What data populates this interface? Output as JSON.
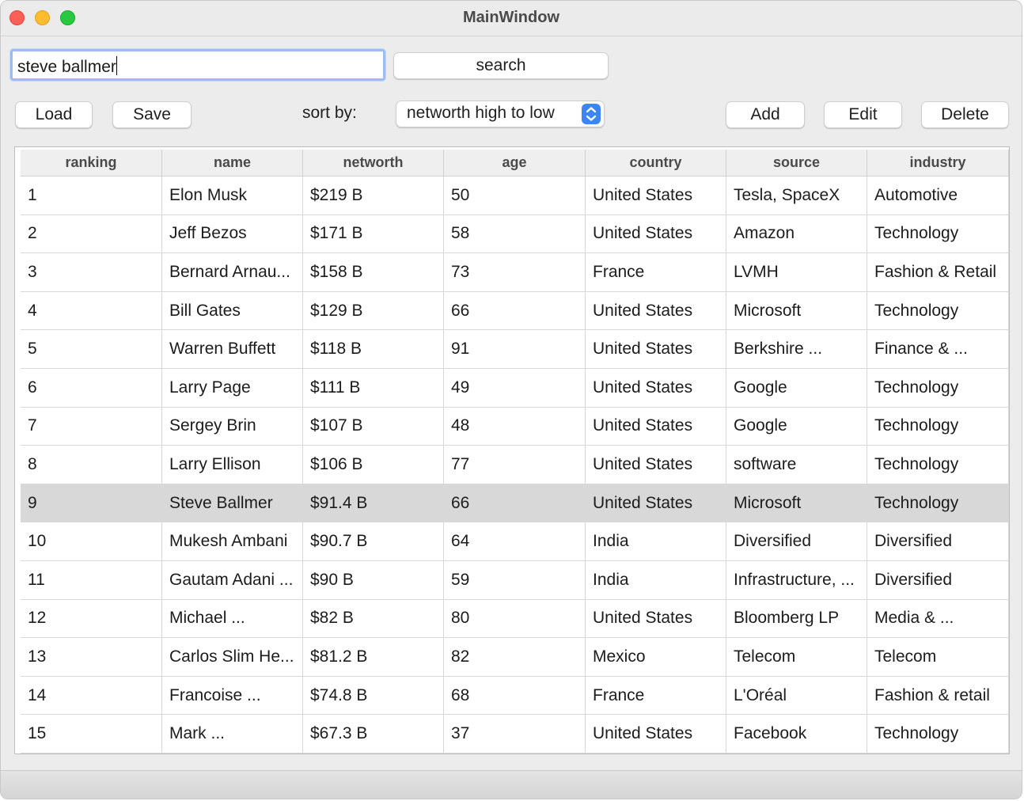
{
  "window": {
    "title": "MainWindow"
  },
  "search": {
    "value": "steve ballmer",
    "button_label": "search"
  },
  "toolbar": {
    "load_label": "Load",
    "save_label": "Save",
    "sort_label": "sort by:",
    "sort_value": "networth high to low",
    "add_label": "Add",
    "edit_label": "Edit",
    "delete_label": "Delete"
  },
  "table": {
    "columns": [
      "ranking",
      "name",
      "networth",
      "age",
      "country",
      "source",
      "industry"
    ],
    "selected_row": 8,
    "rows": [
      [
        "1",
        "Elon Musk",
        "$219 B",
        "50",
        "United States",
        "Tesla, SpaceX",
        "Automotive"
      ],
      [
        "2",
        "Jeff Bezos",
        "$171 B",
        "58",
        "United States",
        "Amazon",
        "Technology"
      ],
      [
        "3",
        "Bernard Arnau...",
        "$158 B",
        "73",
        "France",
        "LVMH",
        "Fashion & Retail"
      ],
      [
        "4",
        "Bill Gates",
        "$129 B",
        "66",
        "United States",
        "Microsoft",
        "Technology"
      ],
      [
        "5",
        "Warren Buffett",
        "$118 B",
        "91",
        "United States",
        "Berkshire ...",
        "Finance & ..."
      ],
      [
        "6",
        "Larry Page",
        "$111 B",
        "49",
        "United States",
        "Google",
        "Technology"
      ],
      [
        "7",
        "Sergey Brin",
        "$107 B",
        "48",
        "United States",
        "Google",
        "Technology"
      ],
      [
        "8",
        "Larry Ellison",
        "$106 B",
        "77",
        "United States",
        "software",
        "Technology"
      ],
      [
        "9",
        "Steve Ballmer",
        "$91.4 B",
        "66",
        "United States",
        "Microsoft",
        "Technology"
      ],
      [
        "10",
        "Mukesh Ambani",
        "$90.7 B",
        "64",
        "India",
        "Diversified",
        "Diversified"
      ],
      [
        "11",
        "Gautam Adani ...",
        "$90 B",
        "59",
        "India",
        "Infrastructure, ...",
        "Diversified"
      ],
      [
        "12",
        "Michael ...",
        "$82 B",
        "80",
        "United States",
        "Bloomberg LP",
        "Media & ..."
      ],
      [
        "13",
        "Carlos Slim He...",
        "$81.2 B",
        "82",
        "Mexico",
        "Telecom",
        "Telecom"
      ],
      [
        "14",
        "Francoise ...",
        "$74.8 B",
        "68",
        "France",
        "L'Oréal",
        "Fashion & retail"
      ],
      [
        "15",
        "Mark ...",
        "$67.3 B",
        "37",
        "United States",
        "Facebook",
        "Technology"
      ]
    ]
  },
  "colors": {
    "accent": "#3a86f7",
    "focus_ring": "#9dbcf0",
    "selected_row": "#d8d8d8",
    "close": "#fe5f57",
    "minimize": "#febc2e",
    "maximize": "#28c840"
  }
}
